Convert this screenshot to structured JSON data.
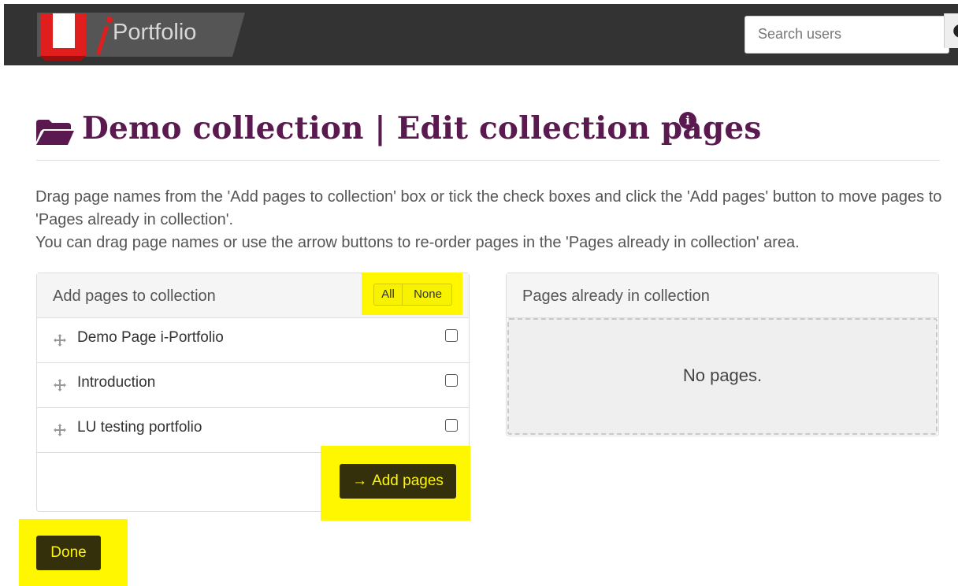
{
  "header": {
    "logo_text": "Portfolio",
    "search_placeholder": "Search users"
  },
  "page": {
    "title": "Demo collection | Edit collection pages",
    "instructions": [
      "Drag page names from the 'Add pages to collection' box or tick the check boxes and click the 'Add pages' button to move pages to 'Pages already in collection'.",
      "You can drag page names or use the arrow buttons to re-order pages in the 'Pages already in collection' area."
    ]
  },
  "add_panel": {
    "title": "Add pages to collection",
    "all_label": "All",
    "none_label": "None",
    "pages": [
      {
        "label": "Demo Page i-Portfolio",
        "checked": false
      },
      {
        "label": "Introduction",
        "checked": false
      },
      {
        "label": "LU testing portfolio",
        "checked": false
      }
    ],
    "add_button_label": "Add pages"
  },
  "collection_panel": {
    "title": "Pages already in collection",
    "empty_text": "No pages."
  },
  "done_label": "Done",
  "colors": {
    "topbar": "#333333",
    "accent_purple": "#5a1a4f",
    "highlight_yellow": "#fff700",
    "button_dark": "#33300b"
  }
}
